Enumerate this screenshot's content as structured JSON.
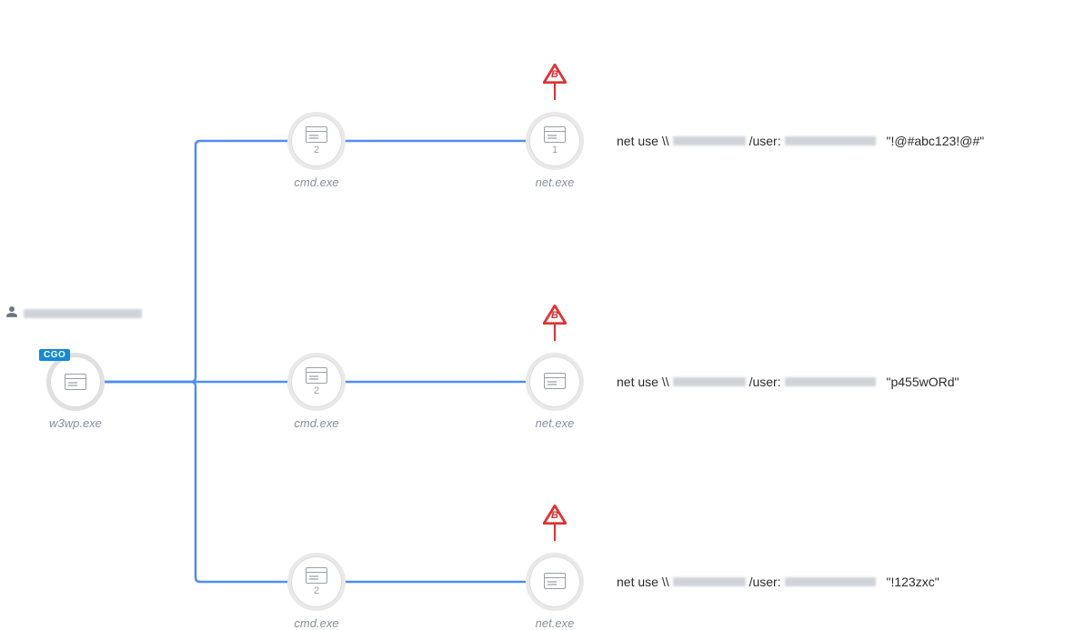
{
  "user_label_redacted": true,
  "root": {
    "label": "w3wp.exe",
    "badge": "CGO"
  },
  "mid_nodes": [
    {
      "label": "cmd.exe",
      "count": "2"
    },
    {
      "label": "cmd.exe",
      "count": "2"
    },
    {
      "label": "cmd.exe",
      "count": "2"
    }
  ],
  "leaf_nodes": [
    {
      "label": "net.exe",
      "count": "1",
      "warning": "B"
    },
    {
      "label": "net.exe",
      "count": "",
      "warning": "B"
    },
    {
      "label": "net.exe",
      "count": "",
      "warning": "B"
    }
  ],
  "commands": [
    {
      "prefix": "net use \\\\",
      "user_prefix": " /user:",
      "password": "\"!@#abc123!@#\""
    },
    {
      "prefix": "net use \\\\",
      "user_prefix": " /user:",
      "password": "\"p455wORd\""
    },
    {
      "prefix": "net use \\\\",
      "user_prefix": " /user:",
      "password": "\"!123zxc\""
    }
  ]
}
